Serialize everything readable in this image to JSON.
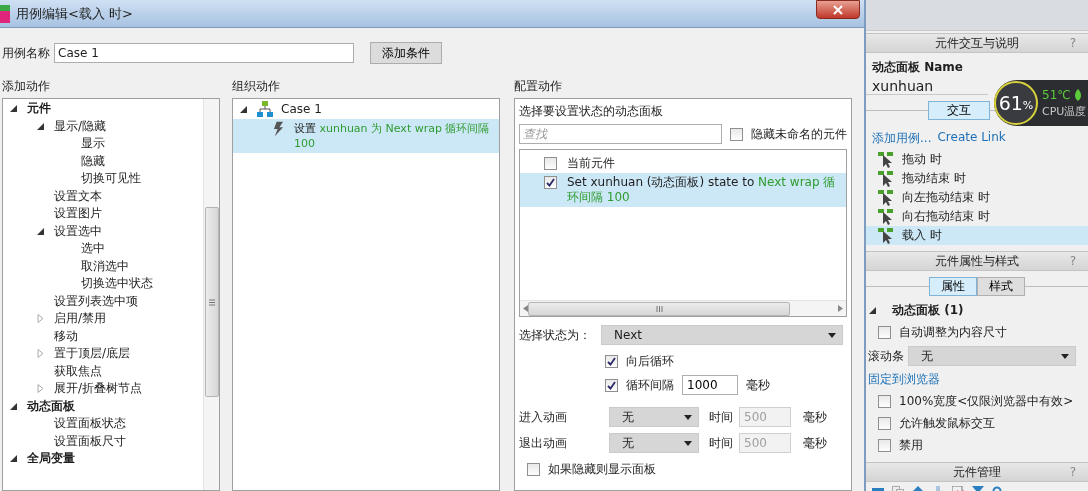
{
  "dialog": {
    "title": "用例编辑<载入 时>",
    "case_name": {
      "label": "用例名称",
      "value": "Case 1"
    },
    "add_condition_button": "添加条件",
    "add_action": {
      "title": "添加动作",
      "tree": [
        {
          "label": "元件",
          "expanded": true,
          "children": [
            {
              "label": "显示/隐藏",
              "expanded": true,
              "children": [
                {
                  "label": "显示"
                },
                {
                  "label": "隐藏"
                },
                {
                  "label": "切换可见性"
                }
              ]
            },
            {
              "label": "设置文本"
            },
            {
              "label": "设置图片"
            },
            {
              "label": "设置选中",
              "expanded": true,
              "children": [
                {
                  "label": "选中"
                },
                {
                  "label": "取消选中"
                },
                {
                  "label": "切换选中状态"
                }
              ]
            },
            {
              "label": "设置列表选中项"
            },
            {
              "label": "启用/禁用",
              "expanded": false
            },
            {
              "label": "移动"
            },
            {
              "label": "置于顶层/底层",
              "expanded": false
            },
            {
              "label": "获取焦点"
            },
            {
              "label": "展开/折叠树节点",
              "expanded": false
            }
          ]
        },
        {
          "label": "动态面板",
          "expanded": true,
          "children": [
            {
              "label": "设置面板状态"
            },
            {
              "label": "设置面板尺寸"
            }
          ]
        },
        {
          "label": "全局变量",
          "expanded": true
        }
      ]
    },
    "organize": {
      "title": "组织动作",
      "case": {
        "label": "Case 1",
        "expanded": true,
        "actions": [
          {
            "verb": "设置",
            "detail": "xunhuan 为 Next wrap 循环间隔 100",
            "selected": true
          }
        ]
      }
    },
    "config": {
      "title": "配置动作",
      "panel_prompt": "选择要设置状态的动态面板",
      "search": {
        "placeholder": "查找"
      },
      "hide_unnamed": {
        "label": "隐藏未命名的元件",
        "checked": false
      },
      "targets": [
        {
          "label": "当前元件",
          "checked": false,
          "selected": false
        },
        {
          "label": "Set xunhuan (动态面板) state to",
          "detail": "Next wrap 循环间隔 100",
          "checked": true,
          "selected": true
        }
      ],
      "state_select": {
        "label": "选择状态为：",
        "value": "Next"
      },
      "wrap": {
        "label": "向后循环",
        "checked": true
      },
      "interval": {
        "label": "循环间隔",
        "checked": true,
        "value": "1000",
        "unit": "毫秒"
      },
      "animations": [
        {
          "label": "进入动画",
          "value": "无",
          "time_label": "时间",
          "time": "500",
          "unit": "毫秒",
          "disabled": true
        },
        {
          "label": "退出动画",
          "value": "无",
          "time_label": "时间",
          "time": "500",
          "unit": "毫秒",
          "disabled": true
        }
      ],
      "show_if_hidden": {
        "label": "如果隐藏则显示面板",
        "checked": false
      }
    }
  },
  "interactions": {
    "title": "元件交互与说明",
    "help": "?",
    "widget_type": "动态面板",
    "name_label": "Name",
    "name_value": "xunhuan",
    "tabs": [
      {
        "label": "交互",
        "selected": true
      }
    ],
    "add_case_link": "添加用例...",
    "create_link": "Create Link",
    "events": [
      {
        "label": "拖动 时",
        "selected": false
      },
      {
        "label": "拖动结束 时",
        "selected": false
      },
      {
        "label": "向左拖动结束 时",
        "selected": false
      },
      {
        "label": "向右拖动结束 时",
        "selected": false
      },
      {
        "label": "载入 时",
        "selected": true
      }
    ]
  },
  "properties": {
    "title": "元件属性与样式",
    "help": "?",
    "tabs": [
      {
        "label": "属性",
        "selected": true
      },
      {
        "label": "样式",
        "selected": false
      }
    ],
    "section": {
      "label": "动态面板 (1)",
      "expanded": true
    },
    "fit_content": {
      "label": "自动调整为内容尺寸",
      "checked": false
    },
    "scrollbar": {
      "label": "滚动条",
      "value": "无"
    },
    "pin_link": "固定到浏览器",
    "options": [
      {
        "label": "100%宽度<仅限浏览器中有效>",
        "checked": false
      },
      {
        "label": "允许触发鼠标交互",
        "checked": false
      },
      {
        "label": "禁用",
        "checked": false
      }
    ]
  },
  "manager": {
    "title": "元件管理",
    "help": "?"
  },
  "cpu_widget": {
    "usage": "61",
    "unit": "%",
    "temperature": "51℃",
    "label": "CPU温度"
  }
}
